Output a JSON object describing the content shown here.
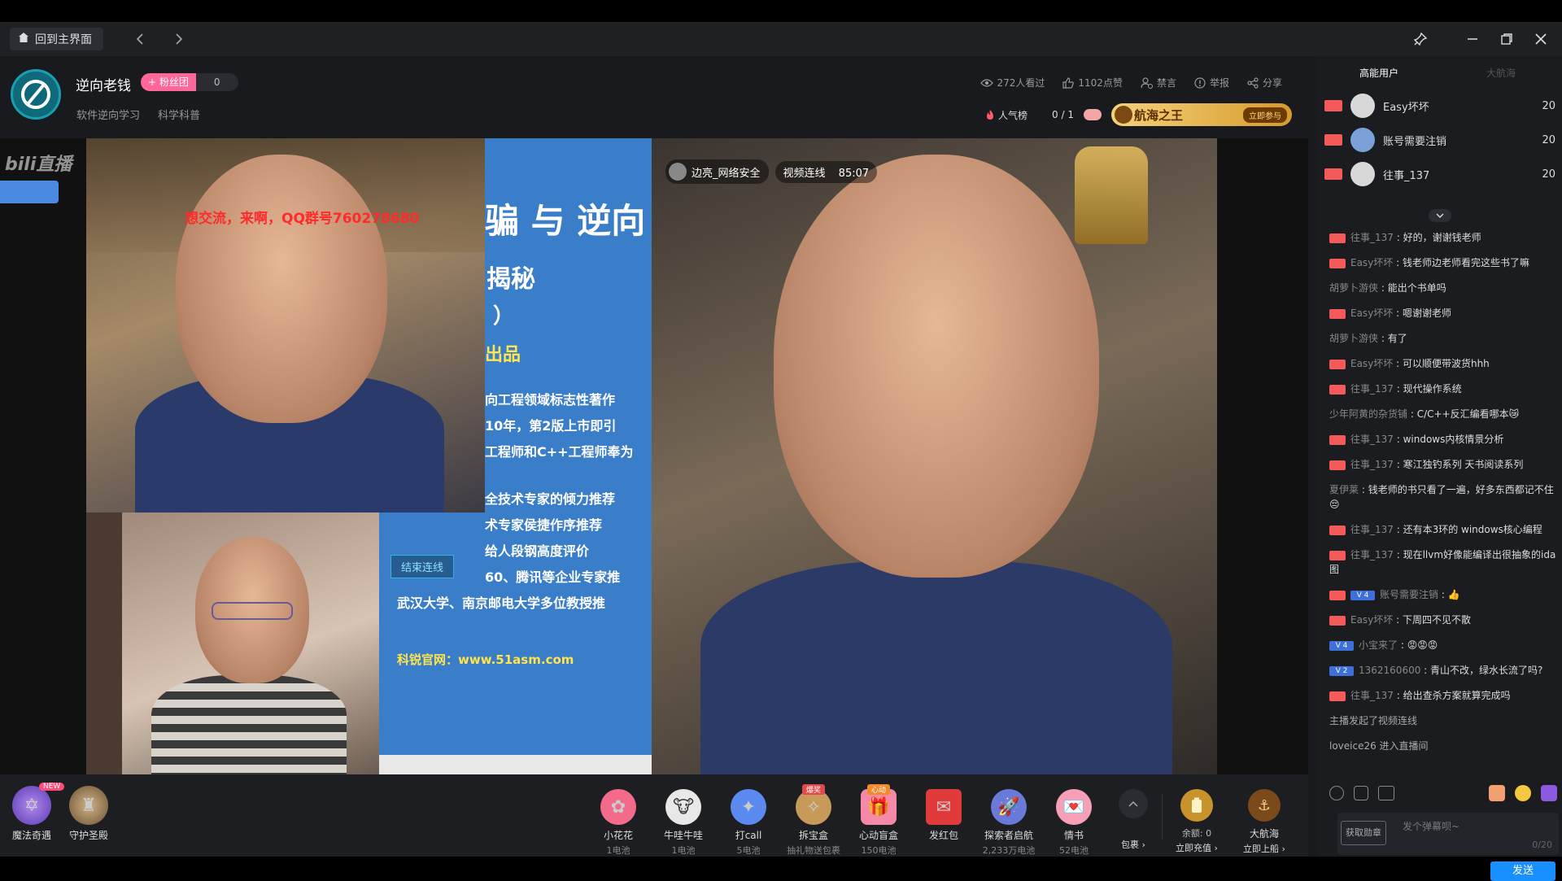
{
  "titlebar": {
    "home_label": "回到主界面"
  },
  "streamer": {
    "name": "逆向老钱",
    "fan_club_label": "+ 粉丝团",
    "fan_club_count": "0",
    "tags": [
      "软件逆向学习",
      "科学科普"
    ]
  },
  "stats": {
    "viewed": "272人看过",
    "likes": "1102点赞",
    "ban": "禁言",
    "report": "举报",
    "share": "分享"
  },
  "rank": {
    "popularity": "人气榜",
    "progress": "0 / 1",
    "voyage_title": "航海之王",
    "voyage_button": "立即参与"
  },
  "video": {
    "qq_banner": "想交流，来啊，QQ群号760278680",
    "end_link_button": "结束连线",
    "link_user": "边亮_网络安全",
    "link_status": "视频连线",
    "link_time": "85:07",
    "slide_lines": [
      "骗 与 逆向",
      "揭秘",
      "）",
      "出品",
      "向工程领域标志性著作",
      "10年，第2版上市即引",
      "工程师和C++工程师奉为",
      "全技术专家的倾力推荐",
      "术专家侯捷作序推荐",
      "给人段钢高度评价",
      "60、腾讯等企业专家推",
      "武汉大学、南京邮电大学多位教授推"
    ],
    "slide_link": "科锐官网：www.51asm.com"
  },
  "bottom": {
    "side_entries": [
      {
        "name": "魔法奇遇",
        "badge": "NEW"
      },
      {
        "name": "守护圣殿"
      }
    ],
    "gifts": [
      {
        "name": "小花花",
        "price": "1电池"
      },
      {
        "name": "牛哇牛哇",
        "price": "1电池"
      },
      {
        "name": "打call",
        "price": "5电池"
      },
      {
        "name": "拆宝盒",
        "price": "抽礼物送包裹",
        "badge": "爆奖"
      },
      {
        "name": "心动盲盒",
        "price": "150电池",
        "badge": "心动"
      },
      {
        "name": "发红包",
        "price": ""
      },
      {
        "name": "探索者启航",
        "price": "2,233万电池"
      },
      {
        "name": "情书",
        "price": "52电池"
      }
    ],
    "package": "包裹 ›",
    "balance": "余额: 0",
    "recharge": "立即充值 ›",
    "voyage_name": "大航海",
    "voyage_action": "立即上船 ›"
  },
  "sidebar": {
    "tab_active": "高能用户",
    "tab_inactive": "大航海",
    "users": [
      {
        "name": "Easy坏坏",
        "score": "20"
      },
      {
        "name": "账号需要注销",
        "score": "20"
      },
      {
        "name": "往事_137",
        "score": "20"
      }
    ],
    "chat": [
      {
        "badge": "red",
        "user": "往事_137",
        "text": "好的，谢谢钱老师"
      },
      {
        "badge": "red",
        "user": "Easy坏坏",
        "text": "钱老师边老师看完这些书了嘛"
      },
      {
        "badge": "",
        "user": "胡萝卜游侠",
        "text": "能出个书单吗"
      },
      {
        "badge": "red",
        "user": "Easy坏坏",
        "text": "嗯谢谢老师"
      },
      {
        "badge": "",
        "user": "胡萝卜游侠",
        "text": "有了"
      },
      {
        "badge": "red",
        "user": "Easy坏坏",
        "text": "可以顺便带波货hhh"
      },
      {
        "badge": "red",
        "user": "往事_137",
        "text": "现代操作系统"
      },
      {
        "badge": "",
        "user": "少年阿黄的杂货铺",
        "text": "C/C++反汇编看哪本😿"
      },
      {
        "badge": "red",
        "user": "往事_137",
        "text": "windows内核情景分析"
      },
      {
        "badge": "red",
        "user": "往事_137",
        "text": "寒江独钓系列 天书阅读系列"
      },
      {
        "badge": "",
        "user": "夏伊莱",
        "text": "钱老师的书只看了一遍，好多东西都记不住😔"
      },
      {
        "badge": "red",
        "user": "往事_137",
        "text": "还有本3环的 windows核心编程"
      },
      {
        "badge": "red",
        "user": "往事_137",
        "text": "现在llvm好像能编译出很抽象的ida图"
      },
      {
        "badge": "blue",
        "badge_text": "V 4",
        "user": "账号需要注销",
        "text": "👍"
      },
      {
        "badge": "red",
        "user": "Easy坏坏",
        "text": "下周四不见不散"
      },
      {
        "badge": "blue",
        "badge_text": "V 4",
        "user": "小宝来了",
        "text": "😡😡😡"
      },
      {
        "badge": "blue",
        "badge_text": "V 2",
        "user": "1362160600",
        "text": "青山不改，绿水长流了吗?"
      },
      {
        "badge": "red",
        "user": "往事_137",
        "text": "给出查杀方案就算完成吗"
      }
    ],
    "system_messages": [
      "主播发起了视频连线",
      "loveice26 进入直播间"
    ],
    "input_coupon": "获取勋章",
    "input_placeholder": "发个弹幕呗~",
    "input_count": "0/20",
    "send": "发送"
  },
  "colors": {
    "accent_pink": "#ff6699",
    "accent_blue": "#1890ff",
    "gold": "#d69a2c"
  }
}
